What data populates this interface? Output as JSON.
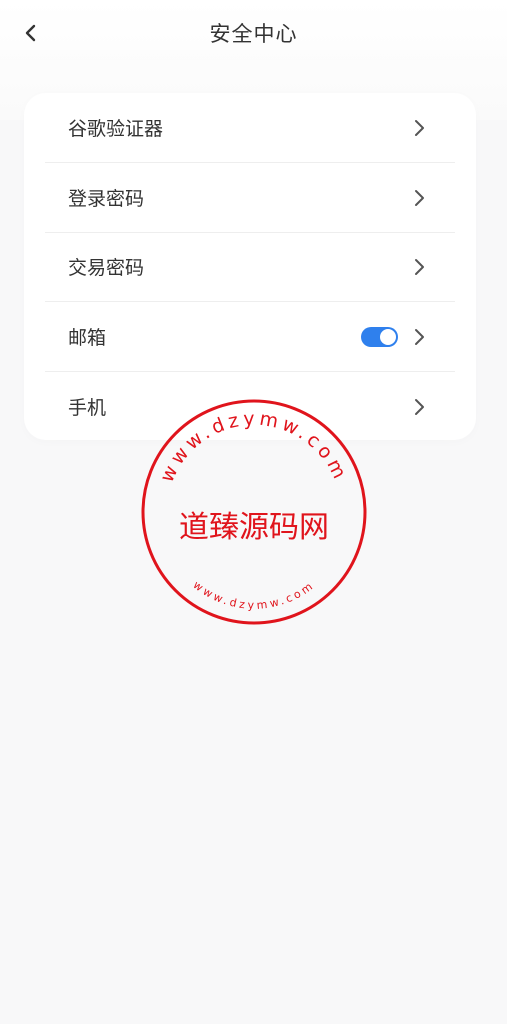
{
  "header": {
    "title": "安全中心",
    "back_icon": "chevron-left-icon"
  },
  "menu": {
    "items": [
      {
        "label": "谷歌验证器"
      },
      {
        "label": "登录密码"
      },
      {
        "label": "交易密码"
      },
      {
        "label": "邮箱",
        "toggle_on": true
      },
      {
        "label": "手机"
      }
    ]
  },
  "watermark": {
    "center_text": "道臻源码网",
    "outer_text": "www.dzymw.com",
    "inner_text": "www.dzymw.com",
    "color": "#e0141c"
  },
  "colors": {
    "accent": "#2f80ed",
    "background": "#f8f8f9"
  }
}
